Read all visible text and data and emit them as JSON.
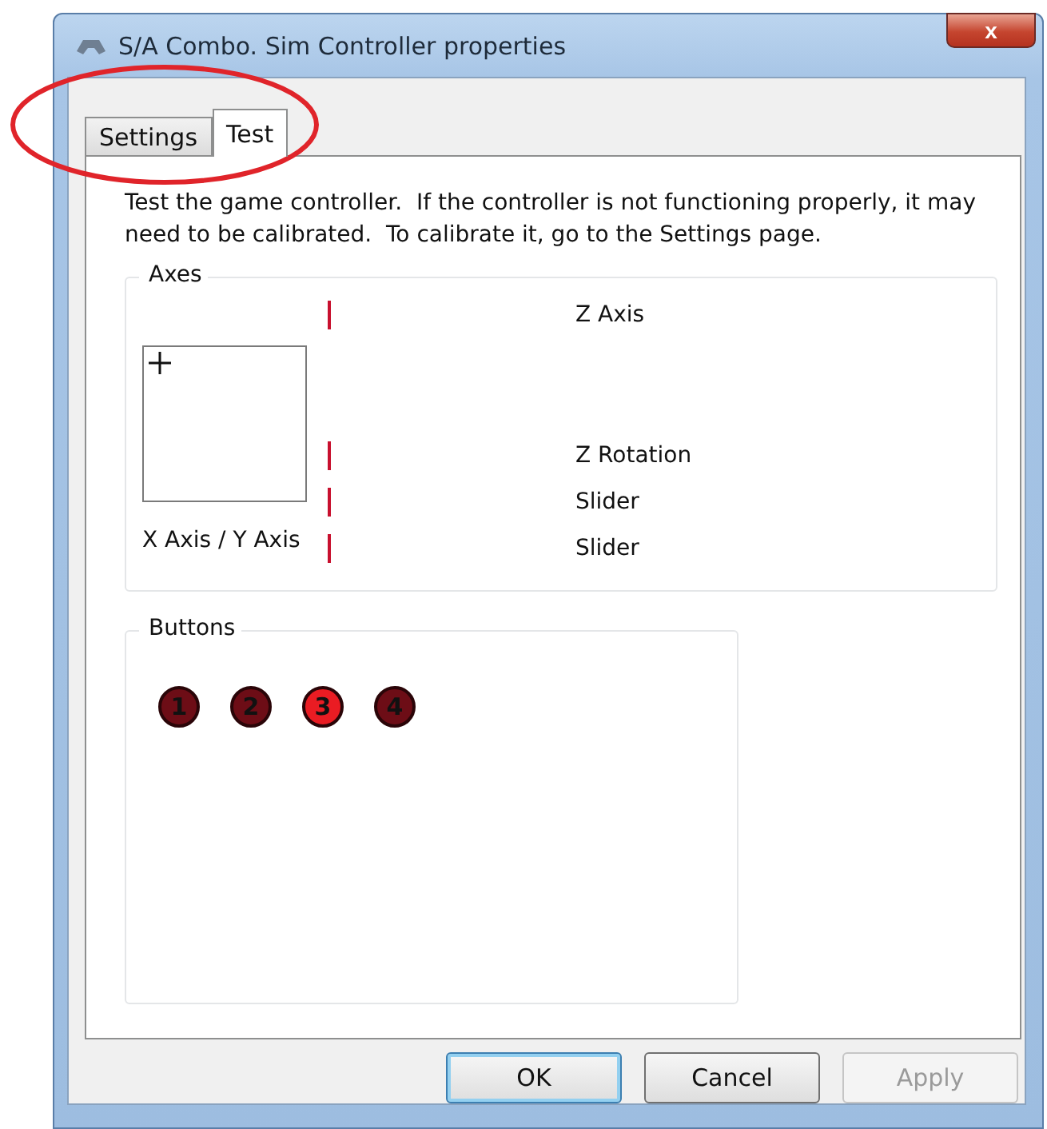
{
  "window": {
    "title": "S/A Combo. Sim Controller properties",
    "close": "x"
  },
  "tabs": [
    {
      "label": "Settings",
      "selected": false
    },
    {
      "label": "Test",
      "selected": true
    }
  ],
  "description": "Test the game controller.  If the controller is not functioning properly, it may need to be calibrated.  To calibrate it, go to the Settings page.",
  "axes": {
    "title": "Axes",
    "xy_label": "X Axis / Y Axis",
    "rows": [
      {
        "label": "Z Axis"
      },
      {
        "label": "Z Rotation"
      },
      {
        "label": "Slider"
      },
      {
        "label": "Slider"
      }
    ]
  },
  "buttons_group": {
    "title": "Buttons",
    "buttons": [
      {
        "label": "1",
        "pressed": false
      },
      {
        "label": "2",
        "pressed": false
      },
      {
        "label": "3",
        "pressed": true
      },
      {
        "label": "4",
        "pressed": false
      }
    ]
  },
  "dialog_buttons": [
    {
      "label": "OK",
      "default": true,
      "disabled": false
    },
    {
      "label": "Cancel",
      "default": false,
      "disabled": false
    },
    {
      "label": "Apply",
      "default": false,
      "disabled": true
    }
  ]
}
